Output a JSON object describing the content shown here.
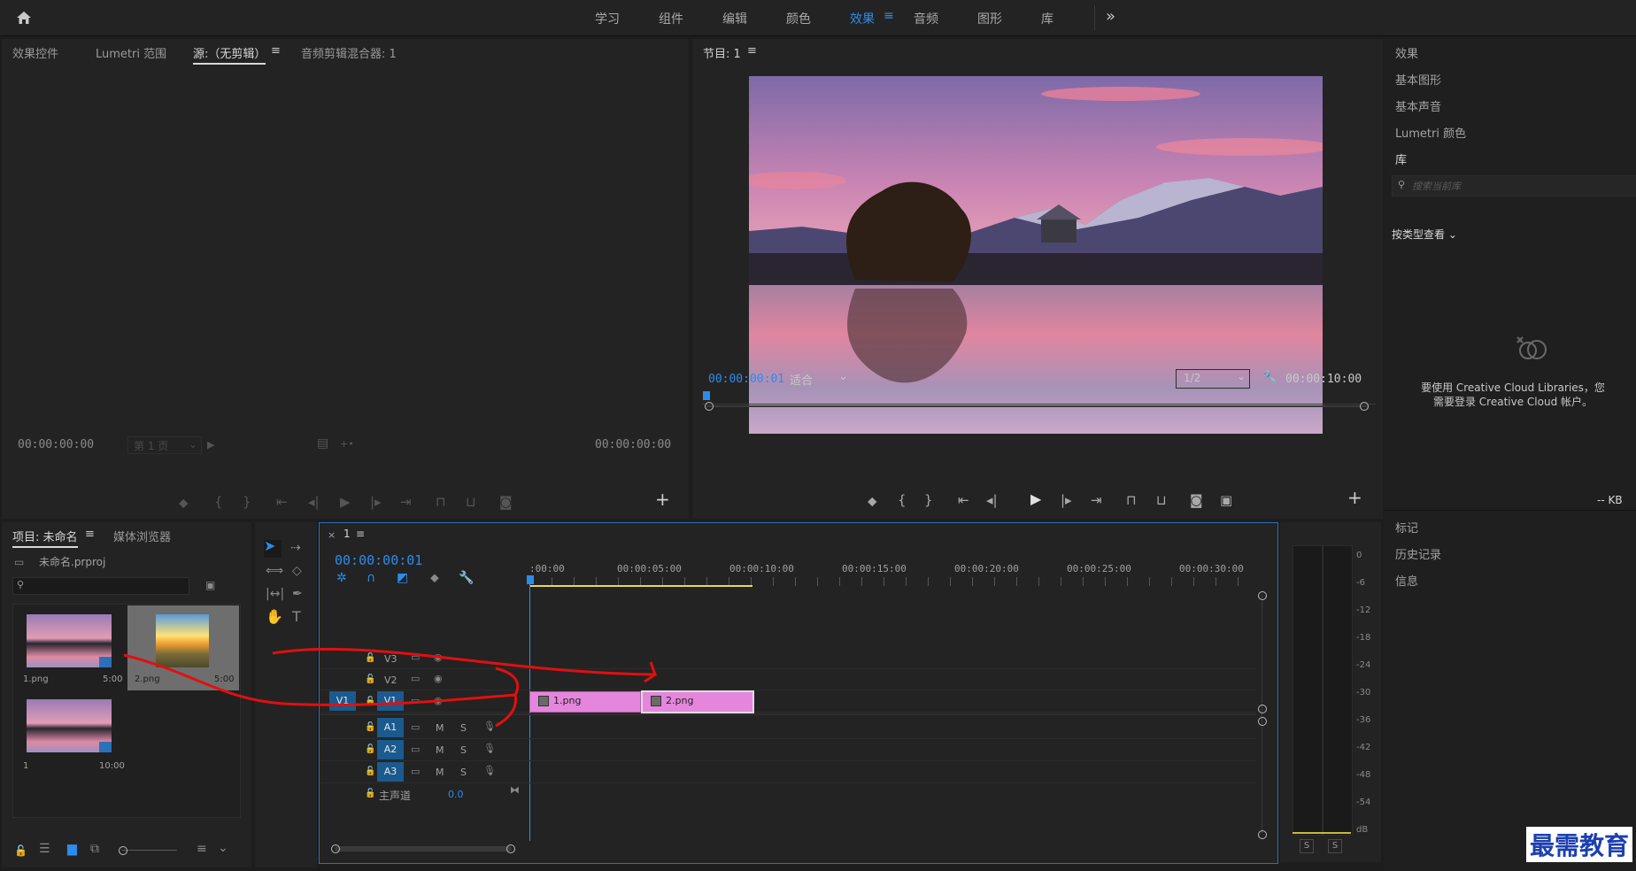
{
  "topbar": {
    "workspaces": [
      "学习",
      "组件",
      "编辑",
      "颜色",
      "效果",
      "音频",
      "图形",
      "库"
    ],
    "active_workspace": "效果",
    "more_label": "»"
  },
  "source_panel": {
    "tabs": [
      "效果控件",
      "Lumetri 范围",
      "源:（无剪辑）",
      "音频剪辑混合器: 1"
    ],
    "selected_tab": "源:（无剪辑）",
    "timecode_left": "00:00:00:00",
    "page_select": "第 1 页",
    "timecode_right": "00:00:00:00"
  },
  "program_panel": {
    "title": "节目: 1",
    "timecode": "00:00:00:01",
    "fit_select": "适合",
    "resolution_select": "1/2",
    "duration": "00:00:10:00"
  },
  "right_panel": {
    "items": [
      "效果",
      "基本图形",
      "基本声音",
      "Lumetri 颜色",
      "库"
    ],
    "search_placeholder": "搜索当前库",
    "view_by_label": "按类型查看",
    "cc_message_line1": "要使用 Creative Cloud Libraries，您",
    "cc_message_line2": "需要登录 Creative Cloud 帐户。",
    "kb_label": "-- KB",
    "lower_items": [
      "标记",
      "历史记录",
      "信息"
    ]
  },
  "project_panel": {
    "tabs": [
      "项目: 未命名",
      "媒体浏览器"
    ],
    "project_file": "未命名.prproj",
    "items": [
      {
        "name": "1.png",
        "duration": "5:00"
      },
      {
        "name": "2.png",
        "duration": "5:00"
      },
      {
        "name": "1",
        "duration": "10:00"
      }
    ]
  },
  "timeline": {
    "sequence_name": "1",
    "timecode": "00:00:00:01",
    "ruler_labels": [
      ":00:00",
      "00:00:05:00",
      "00:00:10:00",
      "00:00:15:00",
      "00:00:20:00",
      "00:00:25:00",
      "00:00:30:00"
    ],
    "video_tracks": [
      "V3",
      "V2",
      "V1"
    ],
    "audio_tracks": [
      "A1",
      "A2",
      "A3"
    ],
    "source_patch": "V1",
    "master_label": "主声道",
    "master_value": "0.0",
    "mute_label": "M",
    "solo_label": "S",
    "clips": [
      {
        "name": "1.png",
        "color": "#e586dd"
      },
      {
        "name": "2.png",
        "color": "#e586dd"
      }
    ]
  },
  "audio_meter": {
    "scale": [
      "0",
      "-6",
      "-12",
      "-18",
      "-24",
      "-30",
      "-36",
      "-42",
      "-48",
      "-54",
      "dB"
    ],
    "solo_buttons": [
      "S",
      "S"
    ]
  },
  "watermark": {
    "text": "最需教育"
  },
  "colors": {
    "accent": "#2d8ceb",
    "clip": "#e586dd",
    "track_button": "#1a5a8f",
    "panel": "#232323",
    "background": "#1d1d1d"
  }
}
